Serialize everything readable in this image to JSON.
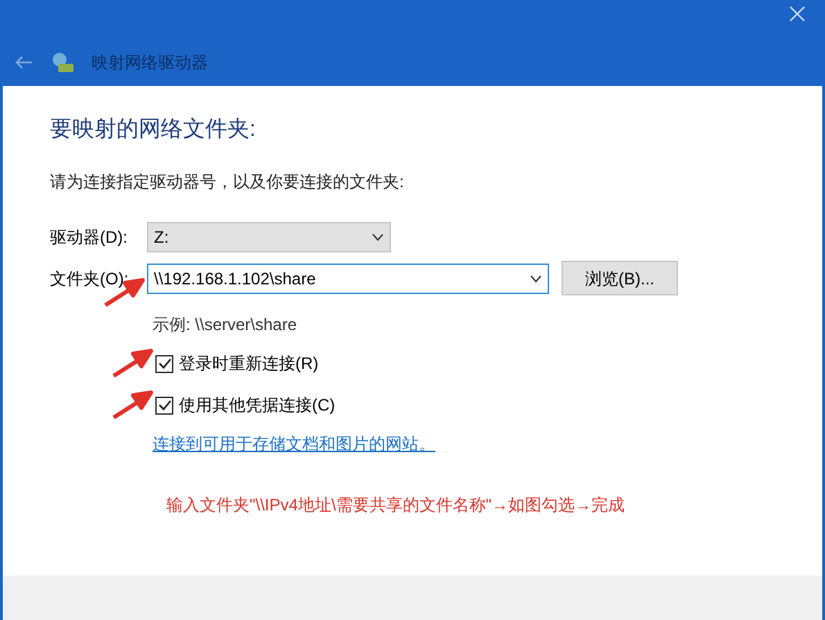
{
  "window": {
    "title": "映射网络驱动器"
  },
  "heading": "要映射的网络文件夹:",
  "instruction": "请为连接指定驱动器号，以及你要连接的文件夹:",
  "drive": {
    "label": "驱动器(D):",
    "value": "Z:"
  },
  "folder": {
    "label": "文件夹(O):",
    "value": "\\\\192.168.1.102\\share",
    "browse": "浏览(B)..."
  },
  "example": "示例: \\\\server\\share",
  "options": [
    {
      "label": "登录时重新连接(R)",
      "checked": true
    },
    {
      "label": "使用其他凭据连接(C)",
      "checked": true
    }
  ],
  "link": "连接到可用于存储文档和图片的网站。",
  "annotation": "输入文件夹\"\\\\IPv4地址\\需要共享的文件名称\"→如图勾选→完成"
}
